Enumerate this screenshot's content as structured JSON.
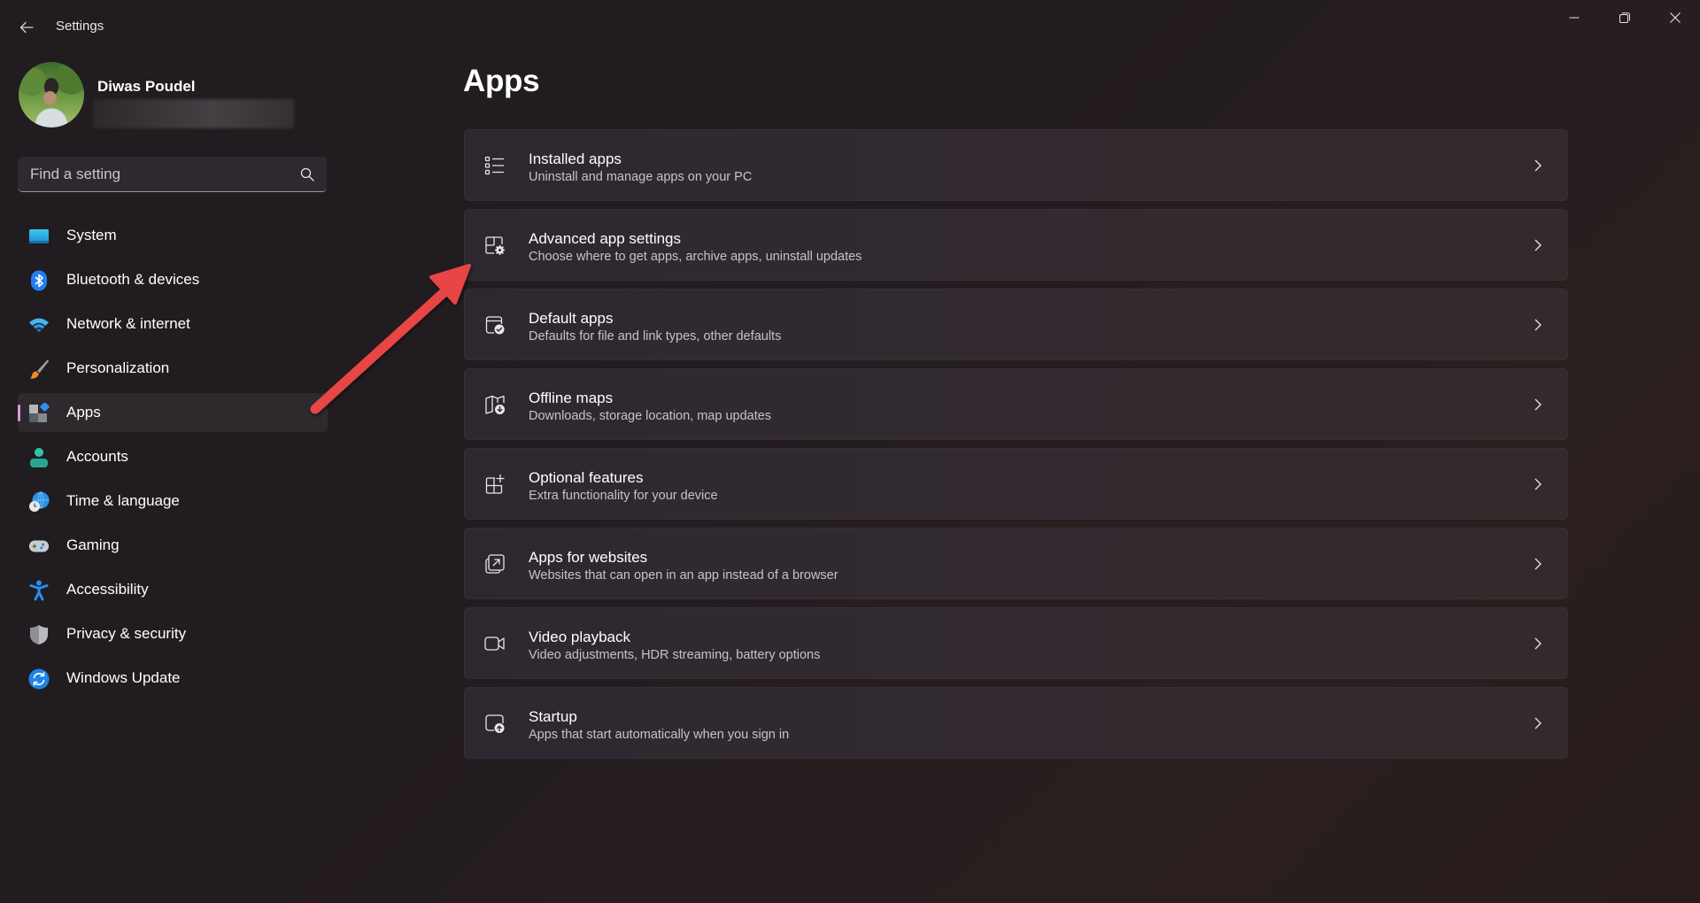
{
  "window": {
    "title": "Settings",
    "controls": {
      "minimize": "minimize-icon",
      "restore": "restore-icon",
      "close": "close-icon"
    },
    "back_icon": "back-arrow-icon"
  },
  "profile": {
    "name": "Diwas Poudel",
    "email_redacted": true
  },
  "search": {
    "placeholder": "Find a setting",
    "value": "",
    "icon": "search-icon"
  },
  "sidebar": {
    "selected_index": 4,
    "accent_color": "#d89ad8",
    "items": [
      {
        "label": "System",
        "icon": "system-monitor-icon"
      },
      {
        "label": "Bluetooth & devices",
        "icon": "bluetooth-icon"
      },
      {
        "label": "Network & internet",
        "icon": "wifi-icon"
      },
      {
        "label": "Personalization",
        "icon": "paintbrush-icon"
      },
      {
        "label": "Apps",
        "icon": "apps-icon"
      },
      {
        "label": "Accounts",
        "icon": "person-icon"
      },
      {
        "label": "Time & language",
        "icon": "globe-clock-icon"
      },
      {
        "label": "Gaming",
        "icon": "gamepad-icon"
      },
      {
        "label": "Accessibility",
        "icon": "accessibility-icon"
      },
      {
        "label": "Privacy & security",
        "icon": "shield-icon"
      },
      {
        "label": "Windows Update",
        "icon": "update-sync-icon"
      }
    ]
  },
  "main": {
    "title": "Apps",
    "cards": [
      {
        "title": "Installed apps",
        "subtitle": "Uninstall and manage apps on your PC",
        "icon": "list-icon"
      },
      {
        "title": "Advanced app settings",
        "subtitle": "Choose where to get apps, archive apps, uninstall updates",
        "icon": "app-settings-gear-icon"
      },
      {
        "title": "Default apps",
        "subtitle": "Defaults for file and link types, other defaults",
        "icon": "default-apps-check-icon"
      },
      {
        "title": "Offline maps",
        "subtitle": "Downloads, storage location, map updates",
        "icon": "map-download-icon"
      },
      {
        "title": "Optional features",
        "subtitle": "Extra functionality for your device",
        "icon": "grid-plus-icon"
      },
      {
        "title": "Apps for websites",
        "subtitle": "Websites that can open in an app instead of a browser",
        "icon": "open-in-app-icon"
      },
      {
        "title": "Video playback",
        "subtitle": "Video adjustments, HDR streaming, battery options",
        "icon": "video-camera-icon"
      },
      {
        "title": "Startup",
        "subtitle": "Apps that start automatically when you sign in",
        "icon": "startup-icon"
      }
    ]
  },
  "annotation": {
    "type": "arrow",
    "color": "#e84545",
    "points_to": "Advanced app settings"
  }
}
